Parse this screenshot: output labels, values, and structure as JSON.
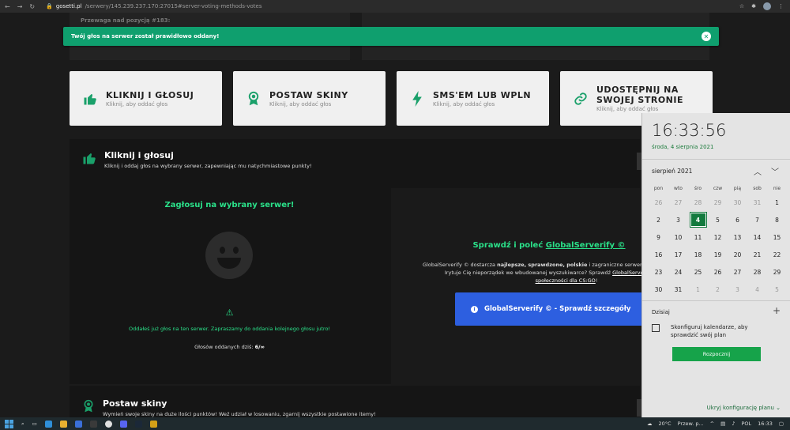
{
  "browser": {
    "url_host": "gosetti.pl",
    "url_path": "/serwery/145.239.237.170:27015#server-voting-methods-votes",
    "nav_back": "←",
    "nav_forward": "→",
    "nav_reload": "↻"
  },
  "page": {
    "faded_header": "Przewaga nad pozycją #183:"
  },
  "toast": {
    "message": "Twój głos na serwer został prawidłowo oddany!",
    "close": "✕"
  },
  "cards": [
    {
      "title": "KLIKNIJ I GŁOSUJ",
      "subtitle": "Kliknij, aby oddać głos",
      "icon": "thumbs-up-icon"
    },
    {
      "title": "POSTAW SKINY",
      "subtitle": "Kliknij, aby oddać głos",
      "icon": "award-icon"
    },
    {
      "title": "SMS'EM LUB WPLN",
      "subtitle": "Kliknij, aby oddać głos",
      "icon": "bolt-icon"
    },
    {
      "title_line1": "UDOSTĘPNIJ NA",
      "title_line2": "SWOJEJ STRONIE",
      "subtitle": "Kliknij, aby oddać głos",
      "icon": "link-icon"
    }
  ],
  "section_vote": {
    "title": "Kliknij i głosuj",
    "subtitle": "Kliknij i oddaj głos na wybrany serwer, zapewniając mu natychmiastowe punkty!",
    "cta": "Zagłosuj na wybrany serwer!",
    "warn_icon": "⚠",
    "info": "Oddałeś już głos na ten serwer. Zapraszamy do oddania kolejnego głosu jutro!",
    "count_label": "Głosów oddanych dziś:",
    "count_value": "6/∞"
  },
  "promo": {
    "title_prefix": "Sprawdź i poleć",
    "title_link": "GlobalServerify ©",
    "p_1": "GlobalServerify © dostarcza",
    "p_bold_1": "najlepsze, sprawdzone, polskie",
    "p_2": "i zagraniczne serwery bezpośrednio dla graczy.",
    "p_3": "Irytuje Cię nieporządek we wbudowanej wyszukiwarce? Sprawdź",
    "p_link": "GlobalServerify © - dołącz do",
    "p_link2": "społeczności dla CS:GO",
    "p_end": "!",
    "button": "GlobalServerify © - Sprawdź szczegóły",
    "button_icon": "i"
  },
  "section_skins": {
    "title": "Postaw skiny",
    "subtitle": "Wymień swoje skiny na duże ilości punktów! Weź udział w losowaniu, zgarnij wszystkie postawione itemy!"
  },
  "flyout": {
    "time": "16:33:56",
    "date": "środa, 4 sierpnia 2021",
    "month": "sierpień 2021",
    "weekdays": [
      "pon",
      "wto",
      "śro",
      "czw",
      "pią",
      "sob",
      "nie"
    ],
    "weeks": [
      [
        "26",
        "27",
        "28",
        "29",
        "30",
        "31",
        "1"
      ],
      [
        "2",
        "3",
        "4",
        "5",
        "6",
        "7",
        "8"
      ],
      [
        "9",
        "10",
        "11",
        "12",
        "13",
        "14",
        "15"
      ],
      [
        "16",
        "17",
        "18",
        "19",
        "20",
        "21",
        "22"
      ],
      [
        "23",
        "24",
        "25",
        "26",
        "27",
        "28",
        "29"
      ],
      [
        "30",
        "31",
        "1",
        "2",
        "3",
        "4",
        "5"
      ]
    ],
    "today_label": "Dzisiaj",
    "plus": "+",
    "event_text": "Skonfiguruj kalendarze, aby sprawdzić swój plan",
    "start_button": "Rozpocznij",
    "hide_link": "Ukryj konfigurację planu"
  },
  "taskbar": {
    "weather": "20°C",
    "weather_text": "Przew. p...",
    "lang": "POL",
    "time": "16:33"
  }
}
